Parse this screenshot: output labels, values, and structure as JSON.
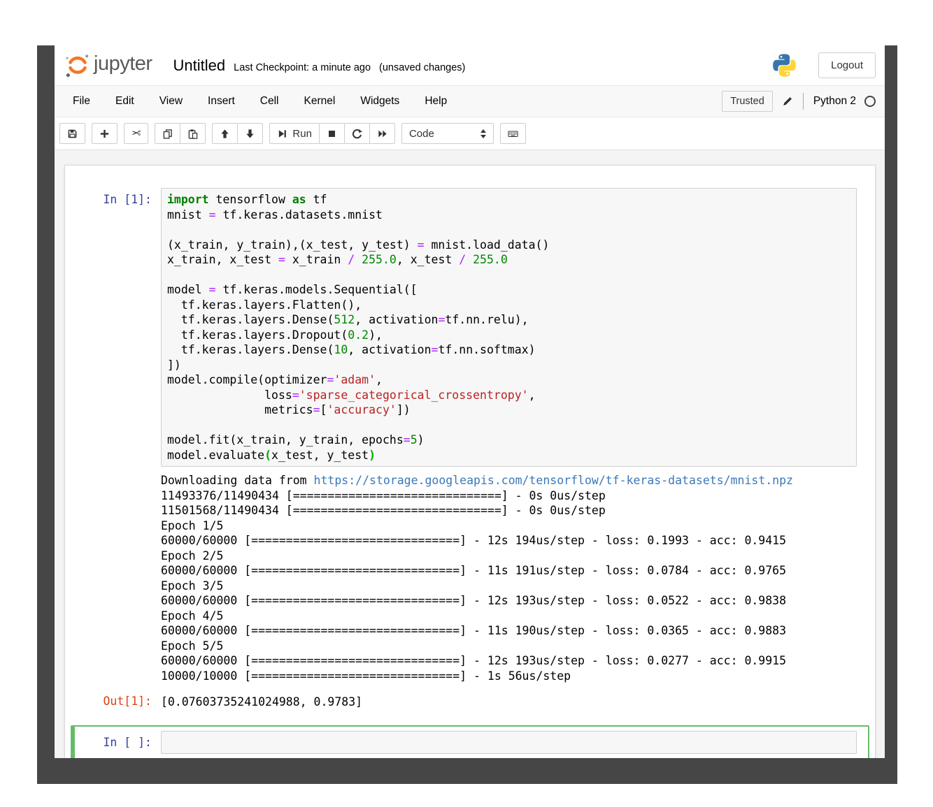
{
  "header": {
    "logo_text": "jupyter",
    "title": "Untitled",
    "checkpoint": "Last Checkpoint: a minute ago",
    "unsaved": "(unsaved changes)",
    "logout_label": "Logout"
  },
  "menu": {
    "items": [
      "File",
      "Edit",
      "View",
      "Insert",
      "Cell",
      "Kernel",
      "Widgets",
      "Help"
    ],
    "trusted_label": "Trusted",
    "kernel_name": "Python 2"
  },
  "toolbar": {
    "run_label": "Run",
    "celltype_value": "Code",
    "button_icons": [
      "save-icon",
      "plus-icon",
      "scissors-icon",
      "copy-icon",
      "paste-icon",
      "arrow-up-icon",
      "arrow-down-icon",
      "step-forward-icon",
      "stop-icon",
      "restart-icon",
      "fast-forward-icon",
      "celltype-select",
      "keyboard-icon"
    ]
  },
  "notebook": {
    "code_cell": {
      "prompt": "In [1]:",
      "code_lines": [
        [
          [
            "kw",
            "import"
          ],
          [
            "pl",
            " tensorflow "
          ],
          [
            "kw",
            "as"
          ],
          [
            "pl",
            " tf"
          ]
        ],
        [
          [
            "pl",
            "mnist "
          ],
          [
            "op",
            "="
          ],
          [
            "pl",
            " tf.keras.datasets.mnist"
          ]
        ],
        [],
        [
          [
            "pl",
            "(x_train, y_train),(x_test, y_test) "
          ],
          [
            "op",
            "="
          ],
          [
            "pl",
            " mnist.load_data()"
          ]
        ],
        [
          [
            "pl",
            "x_train, x_test "
          ],
          [
            "op",
            "="
          ],
          [
            "pl",
            " x_train "
          ],
          [
            "op",
            "/"
          ],
          [
            "pl",
            " "
          ],
          [
            "num",
            "255.0"
          ],
          [
            "pl",
            ", x_test "
          ],
          [
            "op",
            "/"
          ],
          [
            "pl",
            " "
          ],
          [
            "num",
            "255.0"
          ]
        ],
        [],
        [
          [
            "pl",
            "model "
          ],
          [
            "op",
            "="
          ],
          [
            "pl",
            " tf.keras.models.Sequential(["
          ]
        ],
        [
          [
            "pl",
            "  tf.keras.layers.Flatten(),"
          ]
        ],
        [
          [
            "pl",
            "  tf.keras.layers.Dense("
          ],
          [
            "num",
            "512"
          ],
          [
            "pl",
            ", activation"
          ],
          [
            "op",
            "="
          ],
          [
            "pl",
            "tf.nn.relu),"
          ]
        ],
        [
          [
            "pl",
            "  tf.keras.layers.Dropout("
          ],
          [
            "num",
            "0.2"
          ],
          [
            "pl",
            "),"
          ]
        ],
        [
          [
            "pl",
            "  tf.keras.layers.Dense("
          ],
          [
            "num",
            "10"
          ],
          [
            "pl",
            ", activation"
          ],
          [
            "op",
            "="
          ],
          [
            "pl",
            "tf.nn.softmax)"
          ]
        ],
        [
          [
            "pl",
            "])"
          ]
        ],
        [
          [
            "pl",
            "model.compile(optimizer"
          ],
          [
            "op",
            "="
          ],
          [
            "str",
            "'adam'"
          ],
          [
            "pl",
            ","
          ]
        ],
        [
          [
            "pl",
            "              loss"
          ],
          [
            "op",
            "="
          ],
          [
            "str",
            "'sparse_categorical_crossentropy'"
          ],
          [
            "pl",
            ","
          ]
        ],
        [
          [
            "pl",
            "              metrics"
          ],
          [
            "op",
            "="
          ],
          [
            "pl",
            "["
          ],
          [
            "str",
            "'accuracy'"
          ],
          [
            "pl",
            "])"
          ]
        ],
        [],
        [
          [
            "pl",
            "model.fit(x_train, y_train, epochs"
          ],
          [
            "op",
            "="
          ],
          [
            "num",
            "5"
          ],
          [
            "pl",
            ")"
          ]
        ],
        [
          [
            "pl",
            "model.evaluate"
          ],
          [
            "mb",
            "("
          ],
          [
            "pl",
            "x_test, y_test"
          ],
          [
            "mb",
            ")"
          ]
        ]
      ]
    },
    "stream_output_lines": [
      [
        [
          "pl",
          "Downloading data from "
        ],
        [
          "link",
          "https://storage.googleapis.com/tensorflow/tf-keras-datasets/mnist.npz"
        ]
      ],
      [
        [
          "pl",
          "11493376/11490434 [==============================] - 0s 0us/step"
        ]
      ],
      [
        [
          "pl",
          "11501568/11490434 [==============================] - 0s 0us/step"
        ]
      ],
      [
        [
          "pl",
          "Epoch 1/5"
        ]
      ],
      [
        [
          "pl",
          "60000/60000 [==============================] - 12s 194us/step - loss: 0.1993 - acc: 0.9415"
        ]
      ],
      [
        [
          "pl",
          "Epoch 2/5"
        ]
      ],
      [
        [
          "pl",
          "60000/60000 [==============================] - 11s 191us/step - loss: 0.0784 - acc: 0.9765"
        ]
      ],
      [
        [
          "pl",
          "Epoch 3/5"
        ]
      ],
      [
        [
          "pl",
          "60000/60000 [==============================] - 12s 193us/step - loss: 0.0522 - acc: 0.9838"
        ]
      ],
      [
        [
          "pl",
          "Epoch 4/5"
        ]
      ],
      [
        [
          "pl",
          "60000/60000 [==============================] - 11s 190us/step - loss: 0.0365 - acc: 0.9883"
        ]
      ],
      [
        [
          "pl",
          "Epoch 5/5"
        ]
      ],
      [
        [
          "pl",
          "60000/60000 [==============================] - 12s 193us/step - loss: 0.0277 - acc: 0.9915"
        ]
      ],
      [
        [
          "pl",
          "10000/10000 [==============================] - 1s 56us/step"
        ]
      ]
    ],
    "result_output": {
      "prompt": "Out[1]:",
      "value": "[0.07603735241024988, 0.9783]"
    },
    "empty_cell": {
      "prompt": "In [ ]:"
    }
  },
  "colors": {
    "jupyter_orange": "#F37726",
    "python_blue": "#3776AB",
    "python_yellow": "#FFD43B",
    "input_prompt": "#303F9F",
    "output_prompt": "#D84315",
    "selected_cell_border": "#66BB6A",
    "syntax_keyword": "#008000",
    "syntax_operator": "#AA22FF",
    "syntax_number": "#008800",
    "syntax_string": "#BA2121",
    "link": "#3B78B8",
    "window_frame": "#464646"
  }
}
